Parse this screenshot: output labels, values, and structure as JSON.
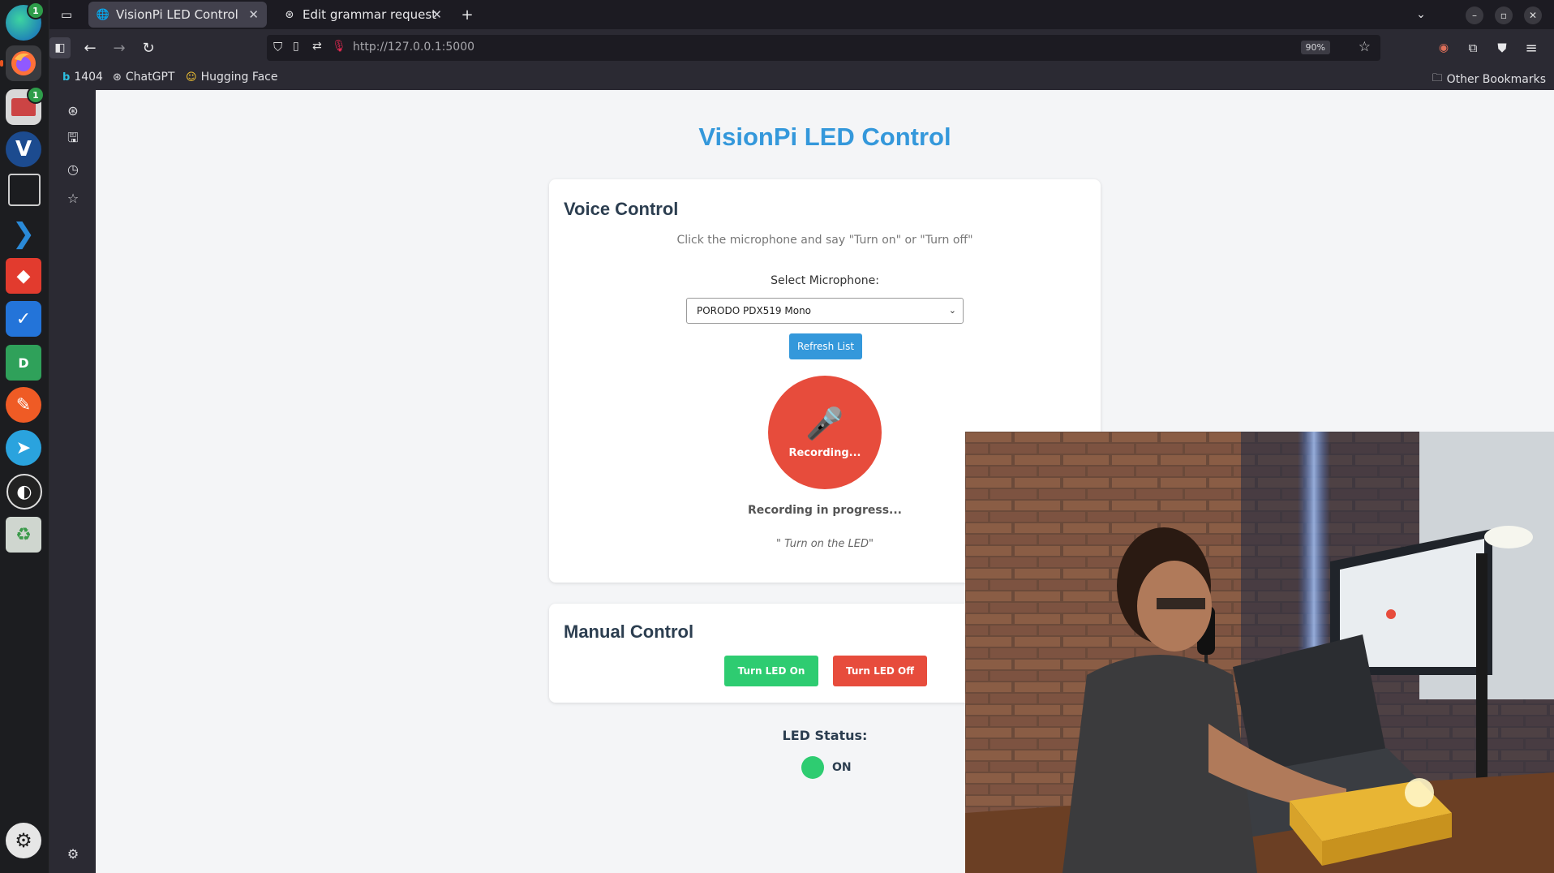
{
  "browser": {
    "tabs": [
      {
        "label": "VisionPi LED Control",
        "active": true
      },
      {
        "label": "Edit grammar request",
        "active": false
      }
    ],
    "url": "http://127.0.0.1:5000",
    "zoom": "90%",
    "bookmarks": [
      "1404",
      "ChatGPT",
      "Hugging Face"
    ],
    "other_bookmarks": "Other Bookmarks"
  },
  "dock": {
    "badges": {
      "edge": "1",
      "files": "1"
    }
  },
  "page": {
    "title": "VisionPi LED Control",
    "voice": {
      "heading": "Voice Control",
      "instructions": "Click the microphone and say \"Turn on\" or \"Turn off\"",
      "select_label": "Select Microphone:",
      "selected_mic": "PORODO PDX519 Mono",
      "refresh_label": "Refresh List",
      "mic_button_label": "Recording...",
      "status": "Recording in progress...",
      "transcript": "\" Turn on the LED\""
    },
    "manual": {
      "heading": "Manual Control",
      "on_label": "Turn LED On",
      "off_label": "Turn LED Off"
    },
    "led": {
      "title": "LED Status:",
      "state": "ON",
      "color": "#2ecc71"
    }
  }
}
